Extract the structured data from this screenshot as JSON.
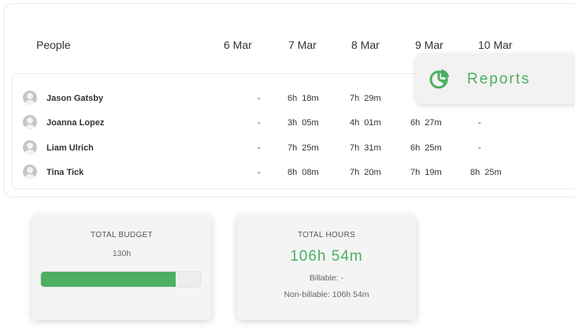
{
  "table": {
    "people_header": "People",
    "dates": [
      "6 Mar",
      "7 Mar",
      "8 Mar",
      "9 Mar",
      "10 Mar"
    ],
    "rows": [
      {
        "name": "Jason Gatsby",
        "hours": [
          "-",
          "6h 18m",
          "7h 29m",
          "",
          ""
        ]
      },
      {
        "name": "Joanna Lopez",
        "hours": [
          "-",
          "3h 05m",
          "4h 01m",
          "6h 27m",
          "-"
        ]
      },
      {
        "name": "Liam Ulrich",
        "hours": [
          "-",
          "7h 25m",
          "7h 31m",
          "6h 25m",
          "-"
        ]
      },
      {
        "name": "Tina Tick",
        "hours": [
          "-",
          "8h 08m",
          "7h 20m",
          "7h 19m",
          "8h 25m"
        ]
      }
    ]
  },
  "reports": {
    "label": "Reports",
    "icon": "pie-chart-icon",
    "color": "#4caf61"
  },
  "budget": {
    "title": "TOTAL BUDGET",
    "value": "130h",
    "progress_fraction": 0.84
  },
  "hours": {
    "title": "TOTAL HOURS",
    "total": "106h 54m",
    "billable": "Billable: -",
    "non_billable": "Non-billable: 106h 54m"
  }
}
